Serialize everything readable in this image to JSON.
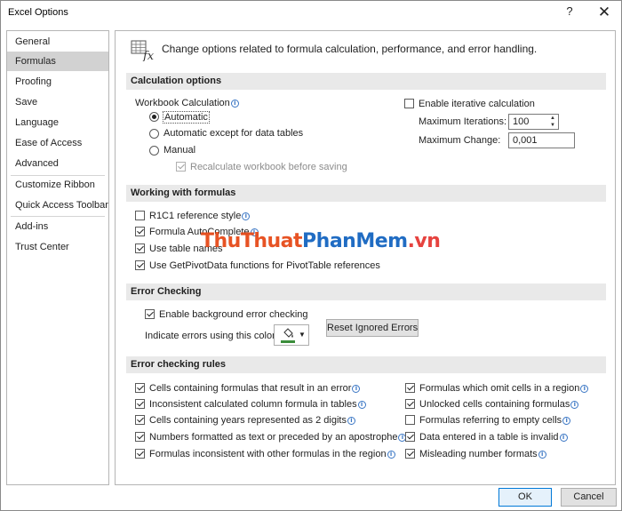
{
  "window": {
    "title": "Excel Options",
    "help": "?",
    "close": "✕"
  },
  "nav": {
    "items": [
      "General",
      "Formulas",
      "Proofing",
      "Save",
      "Language",
      "Ease of Access",
      "Advanced",
      "Customize Ribbon",
      "Quick Access Toolbar",
      "Add-ins",
      "Trust Center"
    ],
    "active": "Formulas"
  },
  "header": {
    "text": "Change options related to formula calculation, performance, and error handling."
  },
  "calc": {
    "title": "Calculation options",
    "workbook_label": "Workbook Calculation",
    "automatic": "Automatic",
    "auto_except": "Automatic except for data tables",
    "manual": "Manual",
    "recalc": "Recalculate workbook before saving",
    "iterative": "Enable iterative calculation",
    "max_iter_label": "Maximum Iterations:",
    "max_iter_value": "100",
    "max_change_label": "Maximum Change:",
    "max_change_value": "0,001"
  },
  "formulas": {
    "title": "Working with formulas",
    "r1c1": "R1C1 reference style",
    "autocomplete": "Formula AutoComplete",
    "table_names": "Use table names",
    "getpivot": "Use GetPivotData functions for PivotTable references"
  },
  "errcheck": {
    "title": "Error Checking",
    "enable_bg": "Enable background error checking",
    "indicate": "Indicate errors using this color:",
    "reset_btn": "Reset Ignored Errors",
    "color": "#3a8d3a"
  },
  "rules": {
    "title": "Error checking rules",
    "left": [
      "Cells containing formulas that result in an error",
      "Inconsistent calculated column formula in tables",
      "Cells containing years represented as 2 digits",
      "Numbers formatted as text or preceded by an apostrophe",
      "Formulas inconsistent with other formulas in the region"
    ],
    "right": [
      "Formulas which omit cells in a region",
      "Unlocked cells containing formulas",
      "Formulas referring to empty cells",
      "Data entered in a table is invalid",
      "Misleading number formats"
    ]
  },
  "footer": {
    "ok": "OK",
    "cancel": "Cancel"
  },
  "watermark": {
    "part1": "Thu",
    "part2": "Thuat",
    "part3": "PhanMem",
    "part4": ".vn"
  }
}
